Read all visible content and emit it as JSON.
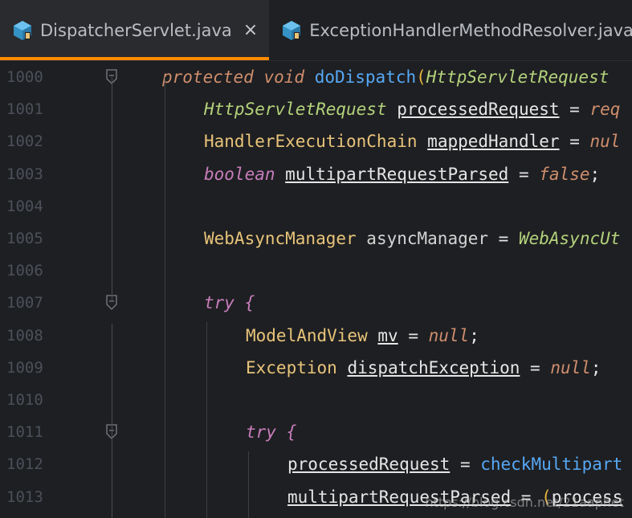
{
  "tabs": [
    {
      "label": "DispatcherServlet.java",
      "close": "×",
      "icon": "java-class-icon"
    },
    {
      "label": "ExceptionHandlerMethodResolver.java",
      "close": "×",
      "icon": "java-class-icon"
    }
  ],
  "colors": {
    "active_tab_accent": "#ff8c00",
    "background": "#1e1f22"
  },
  "lines": [
    {
      "no": "1000",
      "tokens": [
        [
          "kw",
          "protected"
        ],
        [
          "plain",
          " "
        ],
        [
          "kw",
          "void"
        ],
        [
          "plain",
          " "
        ],
        [
          "method",
          "doDispatch"
        ],
        [
          "gold",
          "("
        ],
        [
          "itype",
          "HttpServletRequest"
        ]
      ]
    },
    {
      "no": "1001",
      "tokens": [
        [
          "itype",
          "HttpServletRequest"
        ],
        [
          "plain",
          " "
        ],
        [
          "var",
          "processedRequest"
        ],
        [
          "op",
          " = "
        ],
        [
          "kw",
          "req"
        ]
      ]
    },
    {
      "no": "1002",
      "tokens": [
        [
          "type",
          "HandlerExecutionChain"
        ],
        [
          "plain",
          " "
        ],
        [
          "var",
          "mappedHandler"
        ],
        [
          "op",
          " = "
        ],
        [
          "nul",
          "nul"
        ]
      ]
    },
    {
      "no": "1003",
      "tokens": [
        [
          "kw2",
          "boolean"
        ],
        [
          "plain",
          " "
        ],
        [
          "var",
          "multipartRequestParsed"
        ],
        [
          "op",
          " = "
        ],
        [
          "nul",
          "false"
        ],
        [
          "op",
          ";"
        ]
      ]
    },
    {
      "no": "1004",
      "tokens": []
    },
    {
      "no": "1005",
      "tokens": [
        [
          "type",
          "WebAsyncManager"
        ],
        [
          "plain",
          " asyncManager"
        ],
        [
          "op",
          " = "
        ],
        [
          "itype",
          "WebAsyncUt"
        ]
      ]
    },
    {
      "no": "1006",
      "tokens": []
    },
    {
      "no": "1007",
      "tokens": [
        [
          "kw2",
          "try"
        ],
        [
          "plain",
          " "
        ],
        [
          "kw2",
          "{"
        ]
      ]
    },
    {
      "no": "1008",
      "tokens": [
        [
          "type",
          "ModelAndView"
        ],
        [
          "plain",
          " "
        ],
        [
          "var",
          "mv"
        ],
        [
          "op",
          " = "
        ],
        [
          "nul",
          "null"
        ],
        [
          "op",
          ";"
        ]
      ]
    },
    {
      "no": "1009",
      "tokens": [
        [
          "type",
          "Exception"
        ],
        [
          "plain",
          " "
        ],
        [
          "var",
          "dispatchException"
        ],
        [
          "op",
          " = "
        ],
        [
          "nul",
          "null"
        ],
        [
          "op",
          ";"
        ]
      ]
    },
    {
      "no": "1010",
      "tokens": []
    },
    {
      "no": "1011",
      "tokens": [
        [
          "kw2",
          "try"
        ],
        [
          "plain",
          " "
        ],
        [
          "kw2",
          "{"
        ]
      ]
    },
    {
      "no": "1012",
      "tokens": [
        [
          "var",
          "processedRequest"
        ],
        [
          "op",
          " = "
        ],
        [
          "method",
          "checkMultipart"
        ]
      ]
    },
    {
      "no": "1013",
      "tokens": [
        [
          "var",
          "multipartRequestParsed"
        ],
        [
          "op",
          " = "
        ],
        [
          "gold",
          "("
        ],
        [
          "var",
          "process"
        ]
      ]
    }
  ],
  "watermark": "https://blog.csdn.net/21aaphet"
}
